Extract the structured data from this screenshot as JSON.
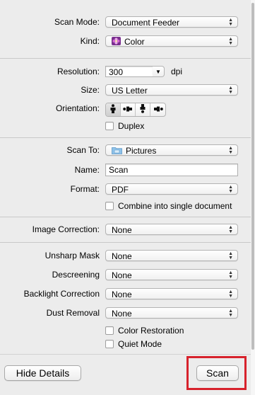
{
  "colors": {
    "highlight": "#d7222c"
  },
  "scan_mode": {
    "label": "Scan Mode:",
    "value": "Document Feeder"
  },
  "kind": {
    "label": "Kind:",
    "value": "Color",
    "icon": "color-flower-icon"
  },
  "resolution": {
    "label": "Resolution:",
    "value": "300",
    "unit": "dpi"
  },
  "size": {
    "label": "Size:",
    "value": "US Letter"
  },
  "orientation": {
    "label": "Orientation:",
    "options": [
      "portrait-upright-icon",
      "rotate-left-icon",
      "upside-down-icon",
      "rotate-right-icon"
    ],
    "selected": 0
  },
  "duplex": {
    "label": "Duplex",
    "checked": false
  },
  "scan_to": {
    "label": "Scan To:",
    "value": "Pictures",
    "icon": "folder-icon"
  },
  "name": {
    "label": "Name:",
    "value": "Scan"
  },
  "format": {
    "label": "Format:",
    "value": "PDF"
  },
  "combine": {
    "label": "Combine into single document",
    "checked": false
  },
  "image_correction": {
    "label": "Image Correction:",
    "value": "None"
  },
  "unsharp_mask": {
    "label": "Unsharp Mask",
    "value": "None"
  },
  "descreening": {
    "label": "Descreening",
    "value": "None"
  },
  "backlight_correction": {
    "label": "Backlight Correction",
    "value": "None"
  },
  "dust_removal": {
    "label": "Dust Removal",
    "value": "None"
  },
  "color_restoration": {
    "label": "Color Restoration",
    "checked": false
  },
  "quiet_mode": {
    "label": "Quiet Mode",
    "checked": false
  },
  "buttons": {
    "hide_details": "Hide Details",
    "scan": "Scan"
  }
}
